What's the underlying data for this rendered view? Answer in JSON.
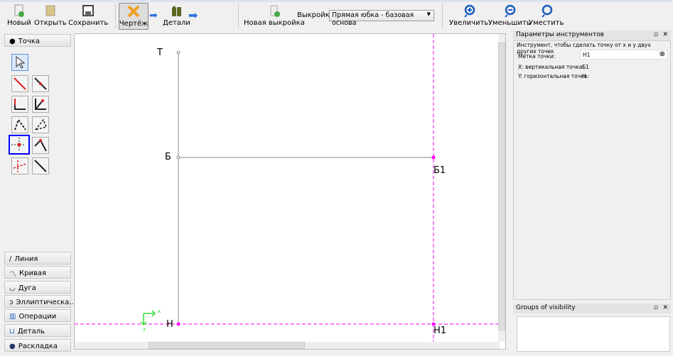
{
  "toolbar": {
    "new": "Новый",
    "open": "Открыть",
    "save": "Сохранить",
    "draft": "Чертёж",
    "details": "Детали",
    "new_pattern": "Новая выкройка",
    "pattern_label": "Выкройка:",
    "pattern_value": "Прямая юбка - базовая основа",
    "zoom_in": "Увеличить",
    "zoom_out": "Уменьшить",
    "fit": "Уместить"
  },
  "sidebar": {
    "point": "Точка",
    "groups": [
      "Линия",
      "Кривая",
      "Дуга",
      "Эллиптическа...",
      "Операции",
      "Деталь",
      "Раскладка"
    ]
  },
  "canvas": {
    "labels": {
      "T": "Т",
      "B": "Б",
      "B1": "Б1",
      "H": "Н",
      "H1": "Н1"
    },
    "axis_x": "x",
    "axis_y": "y"
  },
  "tool_options": {
    "title": "Параметры инструментов",
    "description": "Инструмент, чтобы сделать точку от x и y двух других точек",
    "label_caption": "Метка точки:",
    "label_value": "Н1",
    "x_caption": "X: вертикальная точка:",
    "x_value": "Б1",
    "y_caption": "Y: горизонтальная точка:",
    "y_value": "Н"
  },
  "visibility": {
    "title": "Groups of visibility"
  },
  "colors": {
    "accent": "#ff00ff",
    "selected_tool": "#0000ff"
  }
}
